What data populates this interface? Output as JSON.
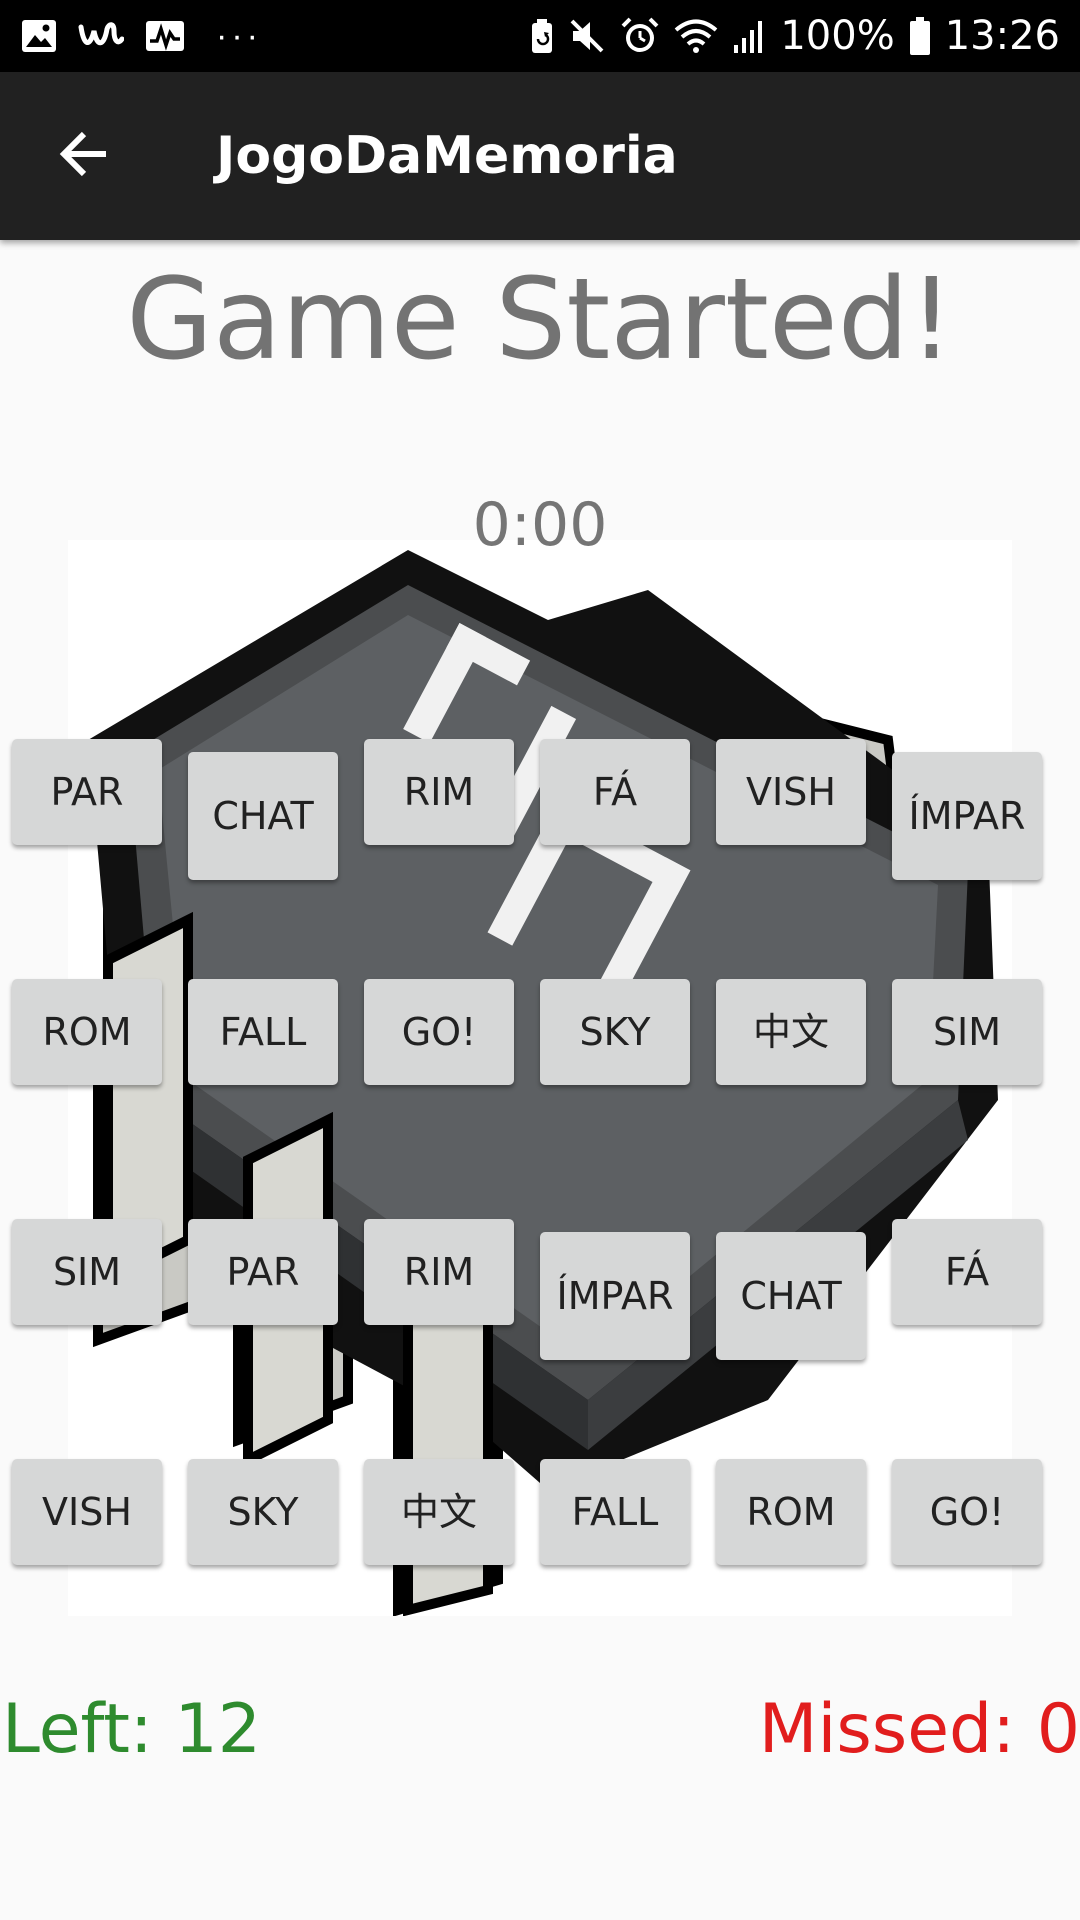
{
  "status_bar": {
    "left_icons": [
      "gallery-icon",
      "wish-icon",
      "activity-icon"
    ],
    "more_notifications": "···",
    "battery_percent": "100%",
    "time": "13:26",
    "right_icons": [
      "battery-saver-icon",
      "mute-icon",
      "alarm-icon",
      "wifi-icon",
      "signal-icon",
      "battery-icon"
    ]
  },
  "app_bar": {
    "back_icon": "arrow-left-icon",
    "title": "JogoDaMemoria"
  },
  "game": {
    "status": "Game Started!",
    "timer": "0:00",
    "left_label": "Left: 12",
    "missed_label": "Missed: 0"
  },
  "background_image": "ROM chip icon",
  "cards": {
    "row1": [
      "PAR",
      "CHAT",
      "RIM",
      "FÁ",
      "VISH",
      "ÍMPAR"
    ],
    "row2": [
      "ROM",
      "FALL",
      "GO!",
      "SKY",
      "中文",
      "SIM"
    ],
    "row3": [
      "SIM",
      "PAR",
      "RIM",
      "ÍMPAR",
      "CHAT",
      "FÁ"
    ],
    "row4": [
      "VISH",
      "SKY",
      "中文",
      "FALL",
      "ROM",
      "GO!"
    ]
  },
  "colors": {
    "app_bar": "#212121",
    "card": "#d6d7d7",
    "left_count": "#2e8b2e",
    "missed_count": "#e11d1d",
    "status_text": "#737373"
  }
}
